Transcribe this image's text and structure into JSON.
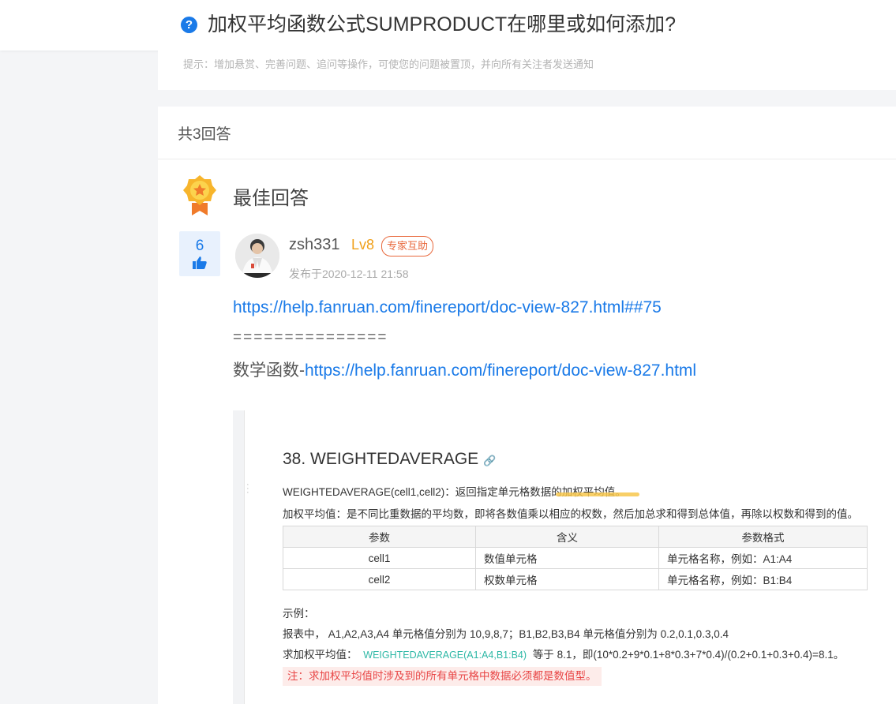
{
  "question": {
    "title": "加权平均函数公式SUMPRODUCT在哪里或如何添加?",
    "icon": "question-icon",
    "hint": "提示：增加悬赏、完善问题、追问等操作，可使您的问题被置顶，并向所有关注者发送通知"
  },
  "answers": {
    "count_label": "共3回答",
    "best_label": "最佳回答",
    "best": {
      "votes": "6",
      "username": "zsh331",
      "level": "Lv8",
      "badge": "专家互助",
      "posted": "发布于2020-12-11 21:58",
      "link1": "https://help.fanruan.com/finereport/doc-view-827.html##75",
      "separator": "===============",
      "line3_prefix": "数学函数-",
      "line3_link": "https://help.fanruan.com/finereport/doc-view-827.html"
    }
  },
  "doc": {
    "title": "38. WEIGHTEDAVERAGE",
    "syntax": "WEIGHTEDAVERAGE(cell1,cell2)：返回指定单元格数据的加权平均值。",
    "definition": "加权平均值：是不同比重数据的平均数，即将各数值乘以相应的权数，然后加总求和得到总体值，再除以权数和得到的值。",
    "table": {
      "headers": [
        "参数",
        "含义",
        "参数格式"
      ],
      "rows": [
        [
          "cell1",
          "数值单元格",
          "单元格名称，例如：A1:A4"
        ],
        [
          "cell2",
          "权数单元格",
          "单元格名称，例如：B1:B4"
        ]
      ]
    },
    "example_label": "示例：",
    "example_line1": "报表中， A1,A2,A3,A4 单元格值分别为 10,9,8,7；B1,B2,B3,B4 单元格值分别为 0.2,0.1,0.3,0.4",
    "example_line2_prefix": "求加权平均值：",
    "example_formula": "WEIGHTEDAVERAGE(A1:A4,B1:B4)",
    "example_line2_suffix": "等于 8.1，即(10*0.2+9*0.1+8*0.3+7*0.4)/(0.2+0.1+0.3+0.4)=8.1。",
    "note": "注：求加权平均值时涉及到的所有单元格中数据必须都是数值型。"
  },
  "colors": {
    "accent": "#1a7ae8",
    "level": "#f0a019",
    "badge": "#e8683c",
    "formula": "#2eb8a6",
    "note": "#e84545"
  }
}
